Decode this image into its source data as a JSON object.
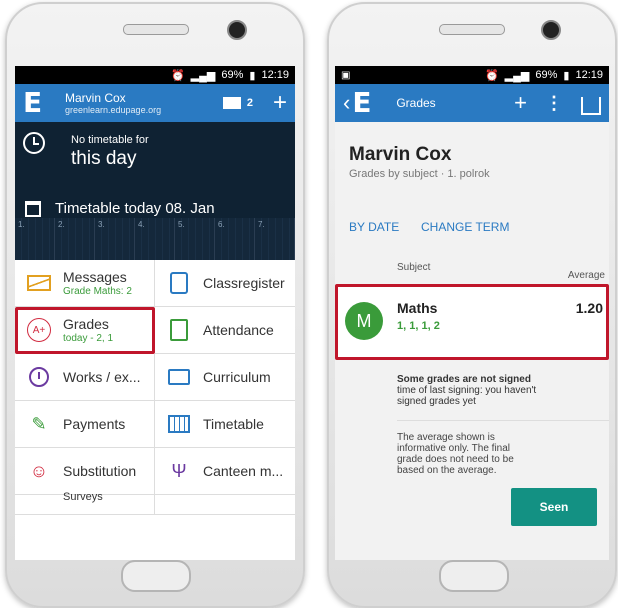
{
  "left": {
    "status": {
      "left": "",
      "battery": "69%",
      "time": "12:19"
    },
    "appbar": {
      "logo": "E",
      "user_name": "Marvin Cox",
      "domain": "greenlearn.edupage.org",
      "mail_count": "2",
      "add_icon": "+"
    },
    "timetable": {
      "no_timetable": "No timetable for",
      "this_day": "this day",
      "today_label": "Timetable today 08. Jan",
      "periods": [
        "1.",
        "2.",
        "3.",
        "4.",
        "5.",
        "6.",
        "7."
      ]
    },
    "menu": [
      {
        "label": "Messages",
        "sub": "Grade Maths: 2",
        "icon": "envelope-icon"
      },
      {
        "label": "Classregister",
        "sub": "",
        "icon": "classregister-icon"
      },
      {
        "label": "Grades",
        "sub": "today - 2, 1",
        "icon": "grades-icon"
      },
      {
        "label": "Attendance",
        "sub": "",
        "icon": "attendance-icon"
      },
      {
        "label": "Works / ex...",
        "sub": "",
        "icon": "clock-icon"
      },
      {
        "label": "Curriculum",
        "sub": "",
        "icon": "briefcase-icon"
      },
      {
        "label": "Payments",
        "sub": "",
        "icon": "money-icon"
      },
      {
        "label": "Timetable",
        "sub": "",
        "icon": "timetable-icon"
      },
      {
        "label": "Substitution",
        "sub": "",
        "icon": "substitution-icon"
      },
      {
        "label": "Canteen m...",
        "sub": "",
        "icon": "canteen-icon"
      }
    ],
    "menu_partial": "Surveys"
  },
  "right": {
    "status": {
      "battery": "69%",
      "time": "12:19"
    },
    "appbar": {
      "back": "‹",
      "logo": "E",
      "title": "Grades",
      "add": "+",
      "more": "⋮"
    },
    "student_name": "Marvin Cox",
    "subtitle": "Grades by subject · 1. polrok",
    "tabs": [
      "BY DATE",
      "CHANGE TERM"
    ],
    "col_subject": "Subject",
    "col_average": "Average",
    "row": {
      "avatar": "M",
      "subject": "Maths",
      "grades": "1, 1, 1, 2",
      "average": "1.20"
    },
    "note_bold": "Some grades are not signed",
    "note_text": "time of last signing: you haven't signed grades yet",
    "info": "The average shown is informative only. The final grade does not need to be based on the average.",
    "seen_button": "Seen"
  },
  "colors": {
    "appbar": "#2a7ac2",
    "dark_panel": "#0f2233",
    "highlight": "#c0162b",
    "green": "#3a9b3a",
    "teal_button": "#139183"
  }
}
